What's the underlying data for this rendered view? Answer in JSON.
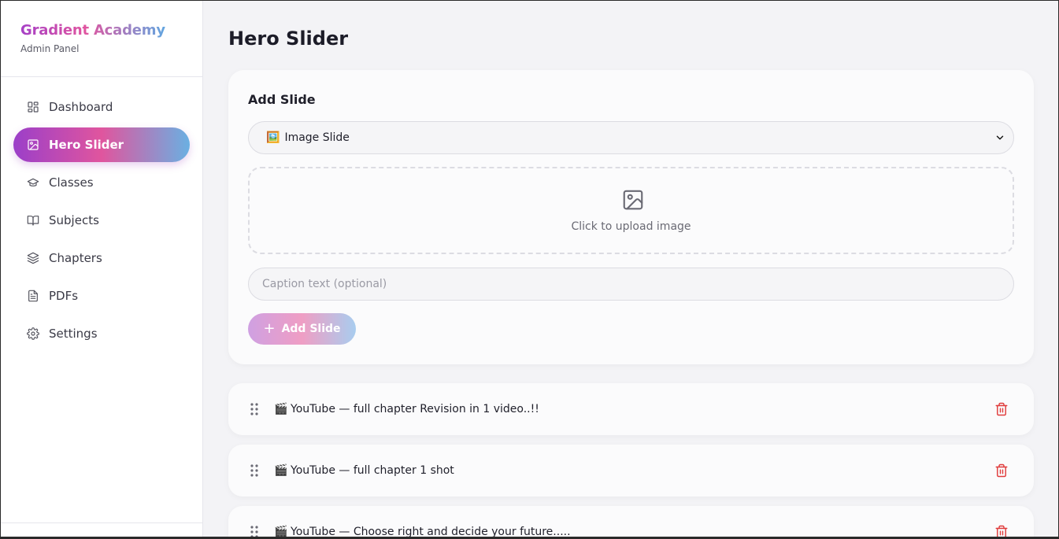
{
  "sidebar": {
    "brand_title": "Gradient Academy",
    "brand_subtitle": "Admin Panel",
    "items": [
      {
        "label": "Dashboard",
        "icon": "dashboard-icon",
        "active": false
      },
      {
        "label": "Hero Slider",
        "icon": "image-icon",
        "active": true
      },
      {
        "label": "Classes",
        "icon": "graduation-cap-icon",
        "active": false
      },
      {
        "label": "Subjects",
        "icon": "book-open-icon",
        "active": false
      },
      {
        "label": "Chapters",
        "icon": "layers-icon",
        "active": false
      },
      {
        "label": "PDFs",
        "icon": "file-text-icon",
        "active": false
      },
      {
        "label": "Settings",
        "icon": "gear-icon",
        "active": false
      }
    ]
  },
  "main": {
    "page_title": "Hero Slider",
    "add_slide": {
      "title": "Add Slide",
      "slide_type": {
        "emoji": "🖼️",
        "selected": "Image Slide"
      },
      "upload_text": "Click to upload image",
      "caption_placeholder": "Caption text (optional)",
      "button_label": "Add Slide"
    },
    "slides": [
      {
        "emoji": "🎬",
        "label": "YouTube — full chapter Revision in 1 video..!!"
      },
      {
        "emoji": "🎬",
        "label": "YouTube — full chapter 1 shot"
      },
      {
        "emoji": "🎬",
        "label": "YouTube — Choose right and decide your future....."
      }
    ]
  },
  "colors": {
    "accent_gradient": [
      "#9b3fc9",
      "#e0559e",
      "#6ab0e2"
    ],
    "delete": "#e03b3b"
  }
}
